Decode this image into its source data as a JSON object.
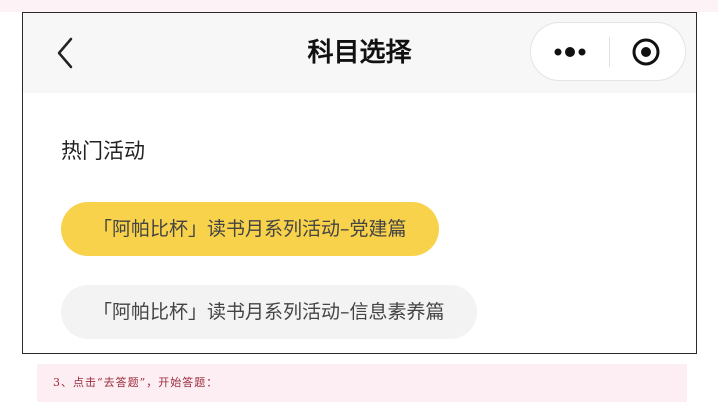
{
  "navbar": {
    "title": "科目选择",
    "back_icon": "chevron-left-icon",
    "more_icon": "more-dots-icon",
    "close_icon": "target-circle-icon"
  },
  "section": {
    "title": "热门活动"
  },
  "activities": [
    {
      "label": "「阿帕比杯」读书月系列活动–党建篇",
      "selected": true
    },
    {
      "label": "「阿帕比杯」读书月系列活动–信息素养篇",
      "selected": false
    }
  ],
  "note": {
    "text": "3、点击“去答题”，开始答题："
  },
  "colors": {
    "accent_yellow": "#f8d24a",
    "inactive_pill": "#f3f3f3",
    "navbar_bg": "#f7f7f7",
    "note_bg": "#fdeef3"
  }
}
